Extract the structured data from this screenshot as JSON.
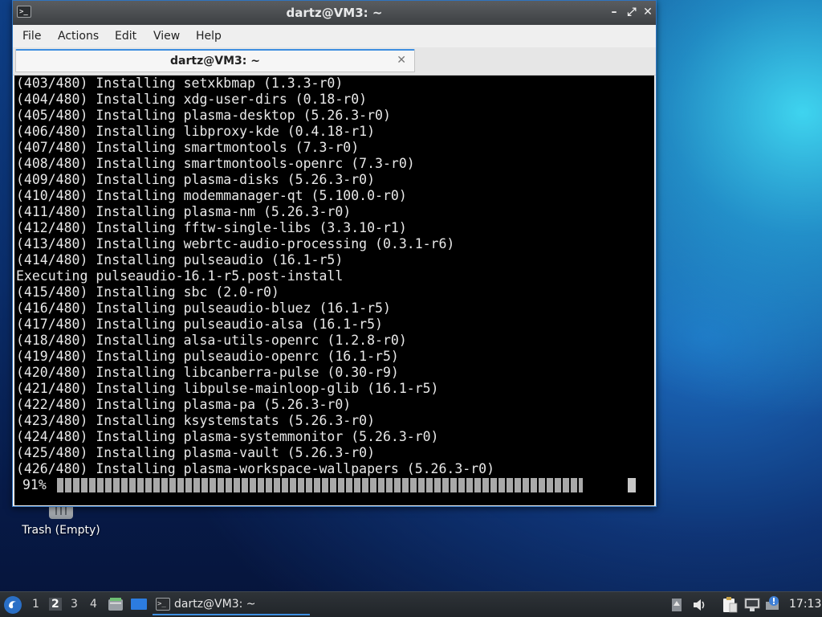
{
  "window": {
    "title": "dartz@VM3: ~",
    "minimize_glyph": "–",
    "maximize_glyph": "⤢",
    "close_glyph": "✕"
  },
  "menu": {
    "file": "File",
    "actions": "Actions",
    "edit": "Edit",
    "view": "View",
    "help": "Help"
  },
  "tab": {
    "title": "dartz@VM3: ~",
    "close_glyph": "✕"
  },
  "terminal": {
    "lines": [
      "(403/480) Installing setxkbmap (1.3.3-r0)",
      "(404/480) Installing xdg-user-dirs (0.18-r0)",
      "(405/480) Installing plasma-desktop (5.26.3-r0)",
      "(406/480) Installing libproxy-kde (0.4.18-r1)",
      "(407/480) Installing smartmontools (7.3-r0)",
      "(408/480) Installing smartmontools-openrc (7.3-r0)",
      "(409/480) Installing plasma-disks (5.26.3-r0)",
      "(410/480) Installing modemmanager-qt (5.100.0-r0)",
      "(411/480) Installing plasma-nm (5.26.3-r0)",
      "(412/480) Installing fftw-single-libs (3.3.10-r1)",
      "(413/480) Installing webrtc-audio-processing (0.3.1-r6)",
      "(414/480) Installing pulseaudio (16.1-r5)",
      "Executing pulseaudio-16.1-r5.post-install",
      "(415/480) Installing sbc (2.0-r0)",
      "(416/480) Installing pulseaudio-bluez (16.1-r5)",
      "(417/480) Installing pulseaudio-alsa (16.1-r5)",
      "(418/480) Installing alsa-utils-openrc (1.2.8-r0)",
      "(419/480) Installing pulseaudio-openrc (16.1-r5)",
      "(420/480) Installing libcanberra-pulse (0.30-r9)",
      "(421/480) Installing libpulse-mainloop-glib (16.1-r5)",
      "(422/480) Installing plasma-pa (5.26.3-r0)",
      "(423/480) Installing ksystemstats (5.26.3-r0)",
      "(424/480) Installing plasma-systemmonitor (5.26.3-r0)",
      "(425/480) Installing plasma-vault (5.26.3-r0)",
      "(426/480) Installing plasma-workspace-wallpapers (5.26.3-r0)"
    ],
    "progress_label": "91%",
    "progress_fraction": 0.91
  },
  "desktop": {
    "trash_label": "Trash (Empty)"
  },
  "taskbar": {
    "workspaces": [
      "1",
      "2",
      "3",
      "4"
    ],
    "active_workspace": "2",
    "task_label": "dartz@VM3: ~",
    "clock": "17:13",
    "accent": "#3d8ee0"
  }
}
